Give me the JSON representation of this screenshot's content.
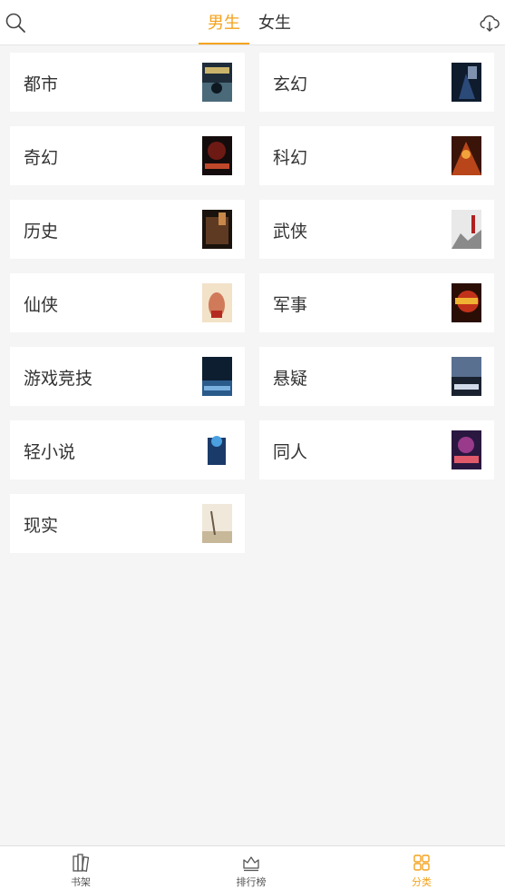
{
  "header": {
    "search_icon": "search-icon",
    "download_icon": "cloud-download-icon",
    "tabs": [
      {
        "label": "男生",
        "active": true
      },
      {
        "label": "女生",
        "active": false
      }
    ]
  },
  "categories": [
    {
      "title": "都市",
      "cover_colors": [
        "#1f2d3a",
        "#4a6a7a",
        "#c9b46a"
      ]
    },
    {
      "title": "玄幻",
      "cover_colors": [
        "#0f1c2e",
        "#2c4a78",
        "#9ab0d0"
      ]
    },
    {
      "title": "奇幻",
      "cover_colors": [
        "#140c0c",
        "#6e1a14",
        "#c0482a"
      ]
    },
    {
      "title": "科幻",
      "cover_colors": [
        "#3a1408",
        "#b8461a",
        "#f2a23a"
      ]
    },
    {
      "title": "历史",
      "cover_colors": [
        "#1a120c",
        "#5e3a22",
        "#c7884a"
      ]
    },
    {
      "title": "武侠",
      "cover_colors": [
        "#e9e9e9",
        "#8a8a8a",
        "#b02020"
      ]
    },
    {
      "title": "仙侠",
      "cover_colors": [
        "#f2e2c8",
        "#d07a5a",
        "#b52a20"
      ]
    },
    {
      "title": "军事",
      "cover_colors": [
        "#2a0e06",
        "#c2321a",
        "#f0b232"
      ]
    },
    {
      "title": "游戏竞技",
      "cover_colors": [
        "#0c1e30",
        "#2a5a8a",
        "#7ab0e0"
      ]
    },
    {
      "title": "悬疑",
      "cover_colors": [
        "#1a2230",
        "#5a7090",
        "#d0dae8"
      ]
    },
    {
      "title": "轻小说",
      "cover_colors": [
        "#ffffff",
        "#1a3a6a",
        "#4aa0e0"
      ]
    },
    {
      "title": "同人",
      "cover_colors": [
        "#2a1840",
        "#9a3a8a",
        "#e05a6a"
      ]
    },
    {
      "title": "现实",
      "cover_colors": [
        "#f0e8da",
        "#c8b89a",
        "#6a5a4a"
      ]
    }
  ],
  "bottom_nav": [
    {
      "label": "书架",
      "icon": "bookshelf-icon",
      "active": false
    },
    {
      "label": "排行榜",
      "icon": "crown-icon",
      "active": false
    },
    {
      "label": "分类",
      "icon": "grid-icon",
      "active": true
    }
  ],
  "colors": {
    "accent": "#f4a21e",
    "background": "#f5f5f5",
    "card": "#ffffff",
    "text": "#333333"
  }
}
